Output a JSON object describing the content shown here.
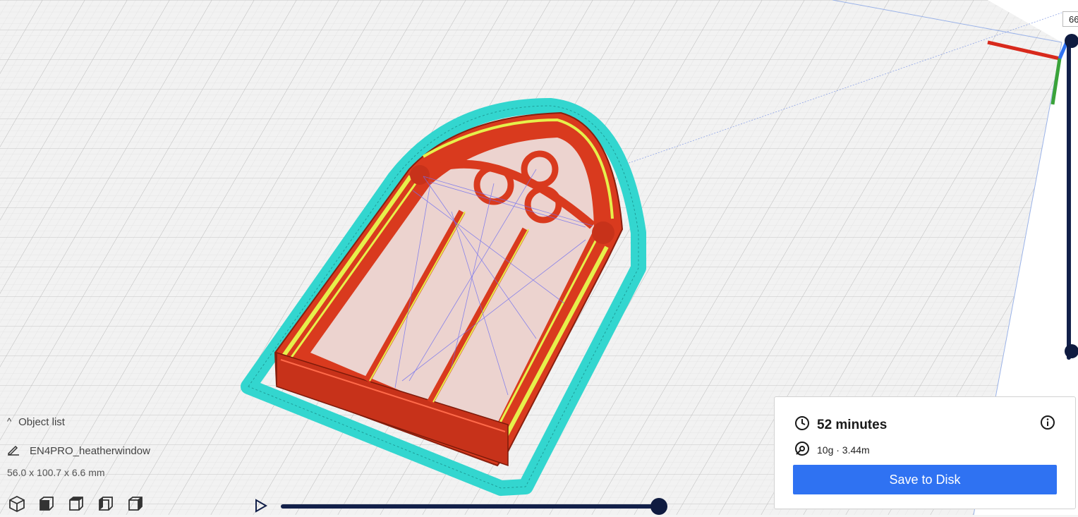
{
  "objects": {
    "header": "Object list",
    "name": "EN4PRO_heatherwindow",
    "dimensions": "56.0 x 100.7 x 6.6 mm"
  },
  "layer_slider": {
    "top_value": "66"
  },
  "print_info": {
    "time": "52 minutes",
    "material": "10g · 3.44m",
    "save_label": "Save to Disk"
  },
  "icons": {
    "collapse": "chevron-up-icon",
    "edit": "pencil-icon",
    "clock": "clock-icon",
    "spool": "spool-icon",
    "info": "info-icon",
    "play": "play-icon",
    "views": [
      "view-3d-icon",
      "view-front-icon",
      "view-top-icon",
      "view-left-icon",
      "view-right-icon"
    ]
  },
  "colors": {
    "accent": "#2f72f2",
    "slider": "#12204a",
    "model_red": "#d93a1e",
    "skirt_cyan": "#33d6cf",
    "infill_yellow": "#e6f04b",
    "grid": "#c9c9c9"
  }
}
